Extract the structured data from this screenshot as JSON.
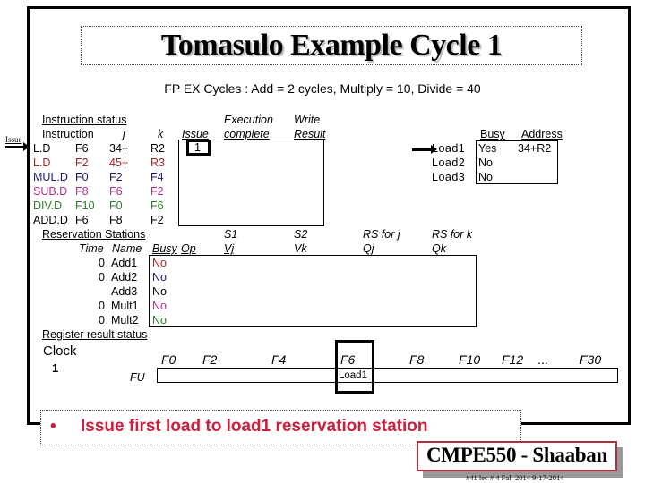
{
  "slide": {
    "title": "Tomasulo Example Cycle 1",
    "subtitle": "FP EX Cycles :  Add = 2 cycles, Multiply = 10, Divide = 40",
    "issue_pointer_label": "Issue"
  },
  "instruction_status": {
    "heading": "Instruction status",
    "columns": {
      "instruction": "Instruction",
      "j": "j",
      "k": "k",
      "issue": "Issue",
      "exec_line1": "Execution",
      "exec_line2": "complete",
      "write_line1": "Write",
      "write_line2": "Result"
    },
    "rows": [
      {
        "op": "L.D",
        "dest": "F6",
        "j": "34+",
        "k": "R2",
        "issue": "1",
        "exec": "",
        "write": "",
        "color": "#000000"
      },
      {
        "op": "L.D",
        "dest": "F2",
        "j": "45+",
        "k": "R3",
        "issue": "",
        "exec": "",
        "write": "",
        "color": "#a02828"
      },
      {
        "op": "MUL.D",
        "dest": "F0",
        "j": "F2",
        "k": "F4",
        "issue": "",
        "exec": "",
        "write": "",
        "color": "#1a1a6e"
      },
      {
        "op": "SUB.D",
        "dest": "F8",
        "j": "F6",
        "k": "F2",
        "issue": "",
        "exec": "",
        "write": "",
        "color": "#b0308a"
      },
      {
        "op": "DIV.D",
        "dest": "F10",
        "j": "F0",
        "k": "F6",
        "issue": "",
        "exec": "",
        "write": "",
        "color": "#2f7a2f"
      },
      {
        "op": "ADD.D",
        "dest": "F6",
        "j": "F8",
        "k": "F2",
        "issue": "",
        "exec": "",
        "write": "",
        "color": "#000000"
      }
    ]
  },
  "load_buffers": {
    "columns": {
      "busy": "Busy",
      "address": "Address"
    },
    "rows": [
      {
        "name": "Load1",
        "busy": "Yes",
        "address": "34+R2"
      },
      {
        "name": "Load2",
        "busy": "No",
        "address": ""
      },
      {
        "name": "Load3",
        "busy": "No",
        "address": ""
      }
    ]
  },
  "reservation_stations": {
    "heading": "Reservation Stations",
    "columns": {
      "time": "Time",
      "name": "Name",
      "busy": "Busy",
      "op": "Op",
      "s1": "S1",
      "vj": "Vj",
      "s2": "S2",
      "vk": "Vk",
      "rsj": "RS for j",
      "qj": "Qj",
      "rsk": "RS for k",
      "qk": "Qk"
    },
    "rows": [
      {
        "time": "0",
        "name": "Add1",
        "busy": "No",
        "busy_color": "#a02828"
      },
      {
        "time": "0",
        "name": "Add2",
        "busy": "No",
        "busy_color": "#1a1a6e"
      },
      {
        "time": "",
        "name": "Add3",
        "busy": "No",
        "busy_color": "#000000"
      },
      {
        "time": "0",
        "name": "Mult1",
        "busy": "No",
        "busy_color": "#b0308a"
      },
      {
        "time": "0",
        "name": "Mult2",
        "busy": "No",
        "busy_color": "#2f7a2f"
      }
    ]
  },
  "register_status": {
    "heading": "Register result status",
    "clock_label": "Clock",
    "clock_value": "1",
    "fu_label": "FU",
    "registers": [
      "F0",
      "F2",
      "F4",
      "F6",
      "F8",
      "F10",
      "F12",
      "...",
      "F30"
    ],
    "fu_values": {
      "F6": "Load1"
    }
  },
  "bullet": {
    "symbol": "•",
    "text": "Issue first load to load1 reservation station"
  },
  "badge": {
    "text": "CMPE550 - Shaaban"
  },
  "footer": {
    "text": "#41   lec # 4 Fall 2014    9-17-2014"
  }
}
